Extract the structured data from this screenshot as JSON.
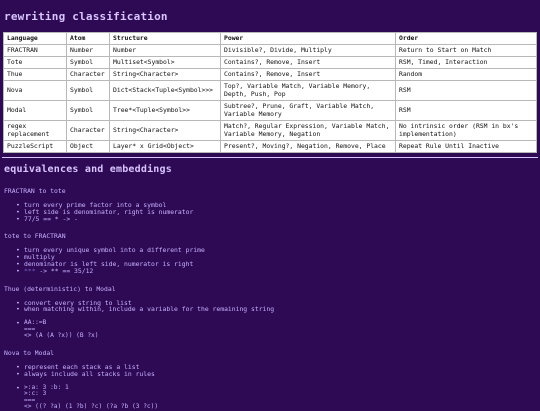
{
  "title": "rewriting classification",
  "table": {
    "headers": [
      "Language",
      "Atom",
      "Structure",
      "Power",
      "Order"
    ],
    "rows": [
      [
        "FRACTRAN",
        "Number",
        "Number",
        "Divisible?, Divide, Multiply",
        "Return to Start on Match"
      ],
      [
        "Tote",
        "Symbol",
        "Multiset<Symbol>",
        "Contains?, Remove, Insert",
        "RSM, Timed, Interaction"
      ],
      [
        "Thue",
        "Character",
        "String<Character>",
        "Contains?, Remove, Insert",
        "Random"
      ],
      [
        "Nova",
        "Symbol",
        "Dict<Stack<Tuple<Symbol>>>",
        "Top?, Variable Match, Variable Memory, Depth, Push, Pop",
        "RSM"
      ],
      [
        "Modal",
        "Symbol",
        "Tree*<Tuple<Symbol>>",
        "Subtree?, Prune, Graft, Variable Match, Variable Memory",
        "RSM"
      ],
      [
        "regex replacement",
        "Character",
        "String<Character>",
        "Match?, Regular Expression, Variable Match, Variable Memory, Negation",
        "No intrinsic order (RSM in bx's implementation)"
      ],
      [
        "PuzzleScript",
        "Object",
        "Layer* x Grid<Object>",
        "Present?, Moving?, Negation, Remove, Place",
        "Repeat Rule Until Inactive"
      ]
    ]
  },
  "section2_title": "equivalences and embeddings",
  "fractran_to_tote": {
    "heading": "FRACTRAN to tote",
    "bullets": [
      "turn every prime factor into a symbol",
      "left side is denominator, right is numerator"
    ],
    "example": "77/5 == * -> -"
  },
  "tote_to_fractran": {
    "heading": "tote to FRACTRAN",
    "bullets": [
      "turn every unique symbol into a different prime",
      "multiply",
      "denominator is left side, numerator is right"
    ],
    "example_dim": "***",
    "example_rest": " -> ** == 35/12"
  },
  "thue_to_modal": {
    "heading": "Thue (deterministic) to Modal",
    "bullets": [
      "convert every string to list",
      "when matching within, include a variable for the remaining string"
    ],
    "code": [
      "AA::=B",
      "===",
      "<> (A (A ?x)) (B ?x)"
    ]
  },
  "nova_to_modal": {
    "heading": "Nova to Modal",
    "bullets": [
      "represent each stack as a list",
      "always include all stacks in rules"
    ],
    "code": [
      ">:a: 3 :b: 1",
      ">:c: 3",
      "===",
      "<> ((? ?a) (1 ?b) ?c) (?a ?b (3 ?c))"
    ]
  }
}
